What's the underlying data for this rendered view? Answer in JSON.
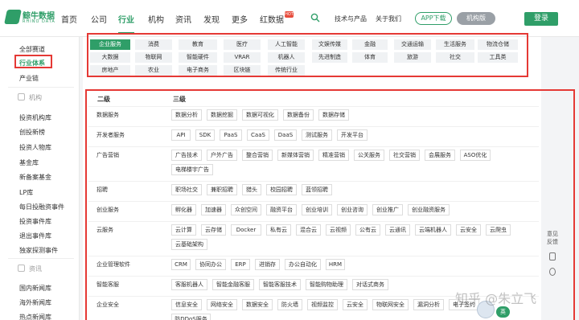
{
  "brand": {
    "name": "鲸牛数据",
    "sub": "RHINO DATA"
  },
  "nav": {
    "items": [
      "首页",
      "公司",
      "行业",
      "机构",
      "资讯",
      "发现",
      "更多",
      "红数据"
    ],
    "active": "行业",
    "hot_badge": "HOT",
    "right_links": [
      "技术与产品",
      "关于我们"
    ],
    "app_label": "APP下载",
    "version_label": "机构版",
    "login_label": "登录"
  },
  "sidebar": {
    "links_top": [
      "全部赛道",
      "行业体系",
      "产业链"
    ],
    "section1": "机构",
    "links_mid": [
      "投资机构库",
      "创投新榜",
      "投资人物库",
      "基金库",
      "新备案基金",
      "LP库",
      "每日投融资事件",
      "投资事件库",
      "退出事件库",
      "独家探测事件"
    ],
    "section2": "资讯",
    "links_bottom": [
      "国内新闻库",
      "海外新闻库",
      "热点新闻库"
    ]
  },
  "categories": [
    [
      "企业服务",
      "消费",
      "教育",
      "医疗",
      "人工智能",
      "文娱传媒",
      "金融",
      "交通运输",
      "生活服务",
      "物流仓储"
    ],
    [
      "大数据",
      "物联网",
      "智能硬件",
      "VRAR",
      "机器人",
      "先进制造",
      "体育",
      "旅游",
      "社交",
      "工具类"
    ],
    [
      "房地产",
      "农业",
      "电子商务",
      "区块链",
      "传统行业"
    ]
  ],
  "table": {
    "head_level2": "二级",
    "head_level3": "三级",
    "rows": [
      {
        "level2": "数据服务",
        "tags": [
          "数据分析",
          "数据挖掘",
          "数据可视化",
          "数据备份",
          "数据存储"
        ]
      },
      {
        "level2": "开发者服务",
        "tags": [
          "API",
          "SDK",
          "PaaS",
          "CaaS",
          "DaaS",
          "测试服务",
          "开发平台"
        ]
      },
      {
        "level2": "广告营销",
        "tags": [
          "广告技术",
          "户外广告",
          "整合营销",
          "新媒体营销",
          "精准营销",
          "公关服务",
          "社交营销",
          "会展服务",
          "ASO优化",
          "电梯楼宇广告"
        ]
      },
      {
        "level2": "招聘",
        "tags": [
          "职场社交",
          "兼职招聘",
          "猎头",
          "校园招聘",
          "蓝领招聘"
        ]
      },
      {
        "level2": "创业服务",
        "tags": [
          "孵化器",
          "加速器",
          "众创空间",
          "融资平台",
          "创业培训",
          "创业咨询",
          "创业推广",
          "创业融资服务"
        ]
      },
      {
        "level2": "云服务",
        "tags": [
          "云计算",
          "云存储",
          "Docker",
          "私有云",
          "混合云",
          "云视频",
          "公有云",
          "云通讯",
          "云端机器人",
          "云安全",
          "云爬虫",
          "云基础架构"
        ]
      },
      {
        "level2": "企业管理软件",
        "tags": [
          "CRM",
          "协同办公",
          "ERP",
          "进销存",
          "办公自动化",
          "HRM"
        ]
      },
      {
        "level2": "智能客服",
        "tags": [
          "客服机器人",
          "智能金融客服",
          "智能客服技术",
          "智能购物助理",
          "对话式商务"
        ]
      },
      {
        "level2": "企业安全",
        "tags": [
          "信息安全",
          "网络安全",
          "数据安全",
          "防火墙",
          "视频监控",
          "云安全",
          "物联网安全",
          "漏洞分析",
          "电子签约",
          "防DDoS服务"
        ]
      }
    ]
  },
  "float": {
    "feedback": [
      "意见",
      "反馈"
    ]
  },
  "watermark": "知乎 @朱立飞",
  "lang_badge": "英",
  "colors": {
    "brand": "#2f9e68",
    "highlight": "#e53935"
  }
}
